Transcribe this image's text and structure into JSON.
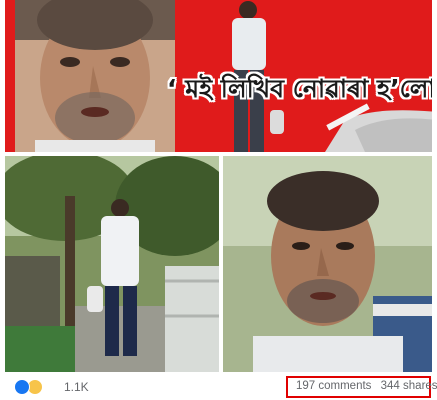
{
  "banner": {
    "caption": "‘ মই লিখিব নোৱাৰা হ’লো...’"
  },
  "footer": {
    "reaction_count": "1.1K",
    "comments": "197 comments",
    "shares": "344 shares"
  },
  "colors": {
    "banner_bg": "#e01b1b",
    "highlight_box": "#e00000",
    "like_blue": "#1877f2",
    "meta_text": "#65676b"
  },
  "icons": [
    "like-reaction-icon",
    "sad-reaction-icon"
  ]
}
